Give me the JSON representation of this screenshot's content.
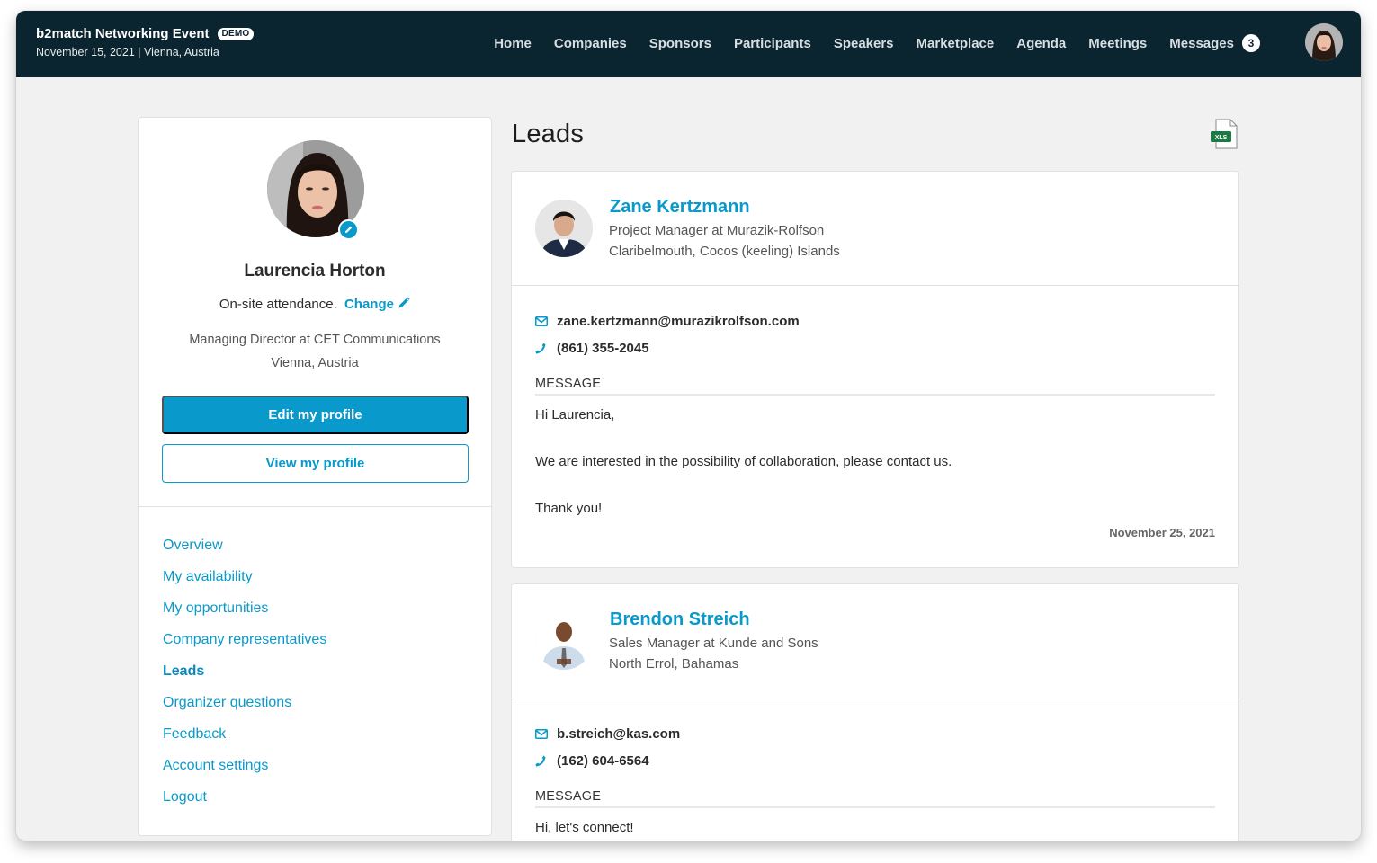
{
  "event": {
    "title": "b2match Networking Event",
    "badge": "DEMO",
    "subtitle": "November 15, 2021 | Vienna, Austria"
  },
  "nav": {
    "items": [
      "Home",
      "Companies",
      "Sponsors",
      "Participants",
      "Speakers",
      "Marketplace",
      "Agenda",
      "Meetings",
      "Messages"
    ],
    "messages_count": "3",
    "avatar": "user-avatar"
  },
  "profile": {
    "name": "Laurencia Horton",
    "attendance": "On-site attendance.",
    "change_label": "Change",
    "role": "Managing Director at CET Communications",
    "location": "Vienna, Austria",
    "edit_button": "Edit my profile",
    "view_button": "View my profile"
  },
  "sidebar_menu": {
    "items": [
      "Overview",
      "My availability",
      "My opportunities",
      "Company representatives",
      "Leads",
      "Organizer questions",
      "Feedback",
      "Account settings",
      "Logout"
    ],
    "active": "Leads"
  },
  "main": {
    "title": "Leads",
    "export_label": "XLS"
  },
  "leads": [
    {
      "name": "Zane Kertzmann",
      "role": "Project Manager at Murazik-Rolfson",
      "location": "Claribelmouth, Cocos (keeling) Islands",
      "email": "zane.kertzmann@murazikrolfson.com",
      "phone": "(861) 355-2045",
      "message_label": "MESSAGE",
      "message": [
        "Hi Laurencia,",
        "We are interested in the possibility of collaboration, please contact us.",
        "Thank you!"
      ],
      "date": "November 25, 2021"
    },
    {
      "name": "Brendon Streich",
      "role": "Sales Manager at Kunde and Sons",
      "location": "North Errol, Bahamas",
      "email": "b.streich@kas.com",
      "phone": "(162) 604-6564",
      "message_label": "MESSAGE",
      "message": [
        "Hi, let's connect!"
      ]
    }
  ],
  "colors": {
    "topbar": "#0b2530",
    "accent": "#0a99cb",
    "background": "#f1f1f1",
    "xls_green": "#1d7a45"
  }
}
